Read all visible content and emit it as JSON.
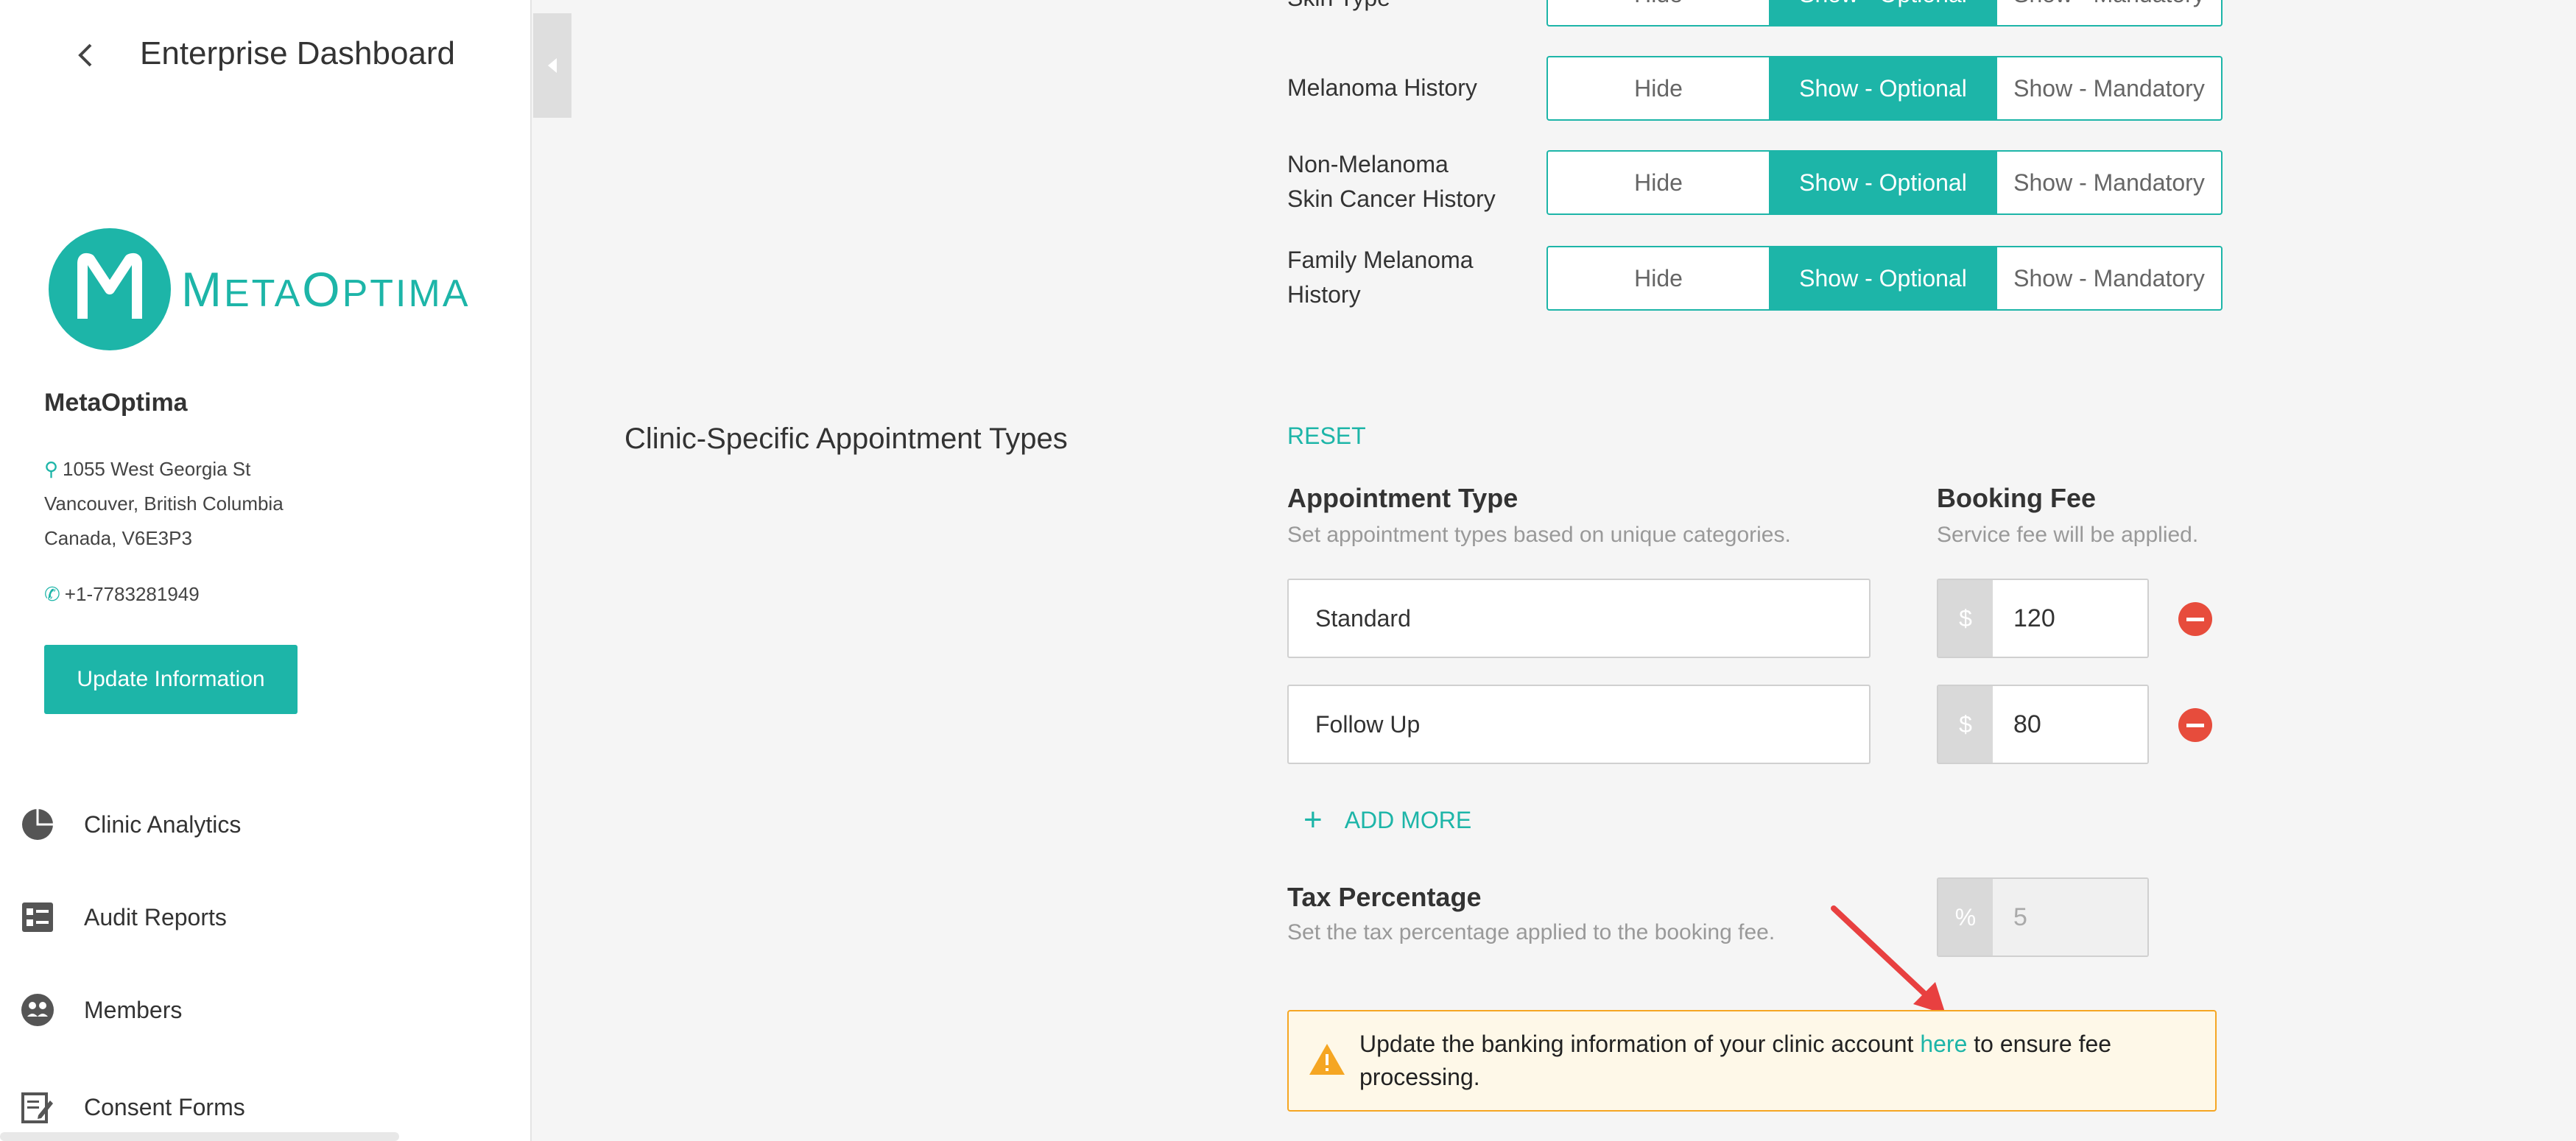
{
  "sidebar": {
    "title": "Enterprise Dashboard",
    "org": {
      "name": "MetaOptima",
      "address_line1": "1055 West Georgia St",
      "address_line2": "Vancouver, British Columbia",
      "address_line3": "Canada, V6E3P3",
      "phone": "+1-7783281949"
    },
    "logo_text_first": "M",
    "logo_text_mid": "ETA",
    "logo_text_o": "O",
    "logo_text_end": "PTIMA",
    "update_button": "Update Information",
    "nav": [
      {
        "label": "Clinic Analytics",
        "icon": "pie-chart-icon"
      },
      {
        "label": "Audit Reports",
        "icon": "report-list-icon"
      },
      {
        "label": "Members",
        "icon": "members-icon"
      },
      {
        "label": "Consent Forms",
        "icon": "edit-form-icon"
      }
    ]
  },
  "fields": {
    "options": {
      "hide": "Hide",
      "optional": "Show - Optional",
      "mandatory": "Show - Mandatory"
    },
    "rows": [
      {
        "label": "Skin Type"
      },
      {
        "label": "Melanoma History"
      },
      {
        "label_line1": "Non-Melanoma",
        "label_line2": "Skin Cancer History"
      },
      {
        "label_line1": "Family Melanoma",
        "label_line2": "History"
      }
    ]
  },
  "appointments": {
    "section_title": "Clinic-Specific Appointment Types",
    "reset": "RESET",
    "type_header": "Appointment Type",
    "type_sub": "Set appointment types based on unique categories.",
    "fee_header": "Booking Fee",
    "fee_sub": "Service fee will be applied.",
    "currency": "$",
    "items": [
      {
        "type": "Standard",
        "fee": "120"
      },
      {
        "type": "Follow Up",
        "fee": "80"
      }
    ],
    "add_more": "ADD MORE",
    "tax_header": "Tax Percentage",
    "tax_sub": "Set the tax percentage applied to the booking fee.",
    "tax_prefix": "%",
    "tax_value": "5"
  },
  "alert": {
    "before": "Update the banking information of your clinic account ",
    "link": "here",
    "after": " to ensure fee processing."
  },
  "colors": {
    "accent": "#1db5a8",
    "danger": "#e74c3c",
    "warning": "#f5a623",
    "annotation": "#e84040"
  }
}
